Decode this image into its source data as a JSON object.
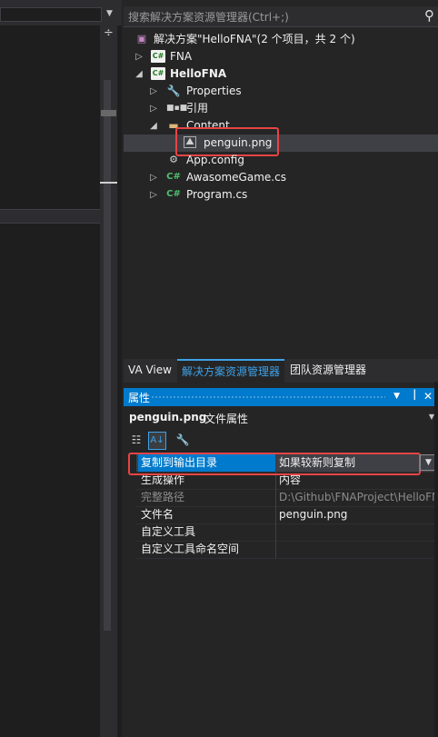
{
  "solution_explorer": {
    "search_placeholder": "搜索解决方案资源管理器(Ctrl+;)",
    "tree": {
      "solution": "解决方案\"HelloFNA\"(2 个项目，共 2 个)",
      "fna": "FNA",
      "hellofna": "HelloFNA",
      "properties": "Properties",
      "references": "引用",
      "content": "Content",
      "penguin": "penguin.png",
      "app_config": "App.config",
      "awasome_game": "AwasomeGame.cs",
      "program": "Program.cs"
    }
  },
  "tabs": {
    "va_view": "VA View",
    "solution_explorer": "解决方案资源管理器",
    "team_explorer": "团队资源管理器"
  },
  "properties": {
    "title": "属性",
    "object_name": "penguin.png",
    "object_type": "文件属性",
    "rows": [
      {
        "name": "复制到输出目录",
        "value": "如果较新则复制"
      },
      {
        "name": "生成操作",
        "value": "内容"
      },
      {
        "name": "完整路径",
        "value": "D:\\Github\\FNAProject\\HelloFN"
      },
      {
        "name": "文件名",
        "value": "penguin.png"
      },
      {
        "name": "自定义工具",
        "value": ""
      },
      {
        "name": "自定义工具命名空间",
        "value": ""
      }
    ]
  },
  "colors": {
    "accent": "#007acc",
    "highlight_box": "#e84444",
    "background": "#252526"
  }
}
